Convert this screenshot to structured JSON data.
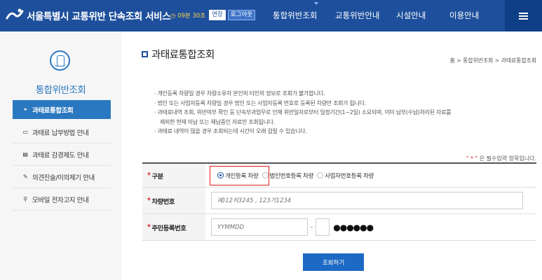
{
  "header": {
    "title": "서울특별시 교통위반 단속조회 서비스",
    "session": {
      "timer": "◷ 09분 30초",
      "extend_label": "연장",
      "logout_label": "로그아웃"
    },
    "nav": [
      "통합위반조회",
      "교통위반안내",
      "시설안내",
      "이용안내"
    ],
    "menu_icon": "hamburger-icon"
  },
  "sidebar": {
    "icon": "car-search-icon",
    "title": "통합위반조회",
    "items": [
      {
        "label": "과태료통합조회",
        "icon": "link-icon",
        "glyph": "⚭",
        "active": true
      },
      {
        "label": "과태료 납부방법 안내",
        "icon": "card-icon",
        "glyph": "▭",
        "active": false
      },
      {
        "label": "과태료 감경제도 안내",
        "icon": "document-icon",
        "glyph": "▤",
        "active": false
      },
      {
        "label": "의견진술/이의제기 안내",
        "icon": "edit-icon",
        "glyph": "✎",
        "active": false
      },
      {
        "label": "모바일 전자고지 안내",
        "icon": "search-icon",
        "glyph": "⚲",
        "active": false
      }
    ]
  },
  "main": {
    "title": "과태료통합조회",
    "breadcrumb": "홈 > 통합위반조회 > 과태료통합조회",
    "notices": [
      "· 개인등록 차량일 경우 차량소유자 본인외 타인의 정보로 조회가 불가합니다.",
      "· 법인 또는 사업자등록 차량일 경우 법인 또는 사업자등록 번호로 등록된 차량만 조회가 됩니다.",
      "· 과태료내역 조회, 위반여부 확인 등 단속부과업무로 인해 위반일자로부터 일정기간(1~2일) 소요되며, 이미 납부(수납)처리된 자료를",
      "  제외한 현재 미납 또는 체납중인 자료만 조회됩니다.",
      "· 과태료 내역이 많을 경우 조회되는데 시간이 오래 걸릴 수 있습니다."
    ],
    "required_note_star": "\" * \"",
    "required_note": " 은 필수입력 항목입니다.",
    "form": {
      "type_label": "구분",
      "type_options": [
        "개인등록 차량",
        "법인번호등록 차량",
        "사업자번호등록 차량"
      ],
      "type_selected": "개인등록 차량",
      "car_label": "차량번호",
      "car_placeholder": "예)12허3245 , 123가1234",
      "rrn_label": "주민등록번호",
      "rrn_placeholder": "YYMMDD",
      "rrn_separator": "-",
      "rrn_mask": "●●●●●●"
    },
    "submit_label": "조회하기"
  }
}
